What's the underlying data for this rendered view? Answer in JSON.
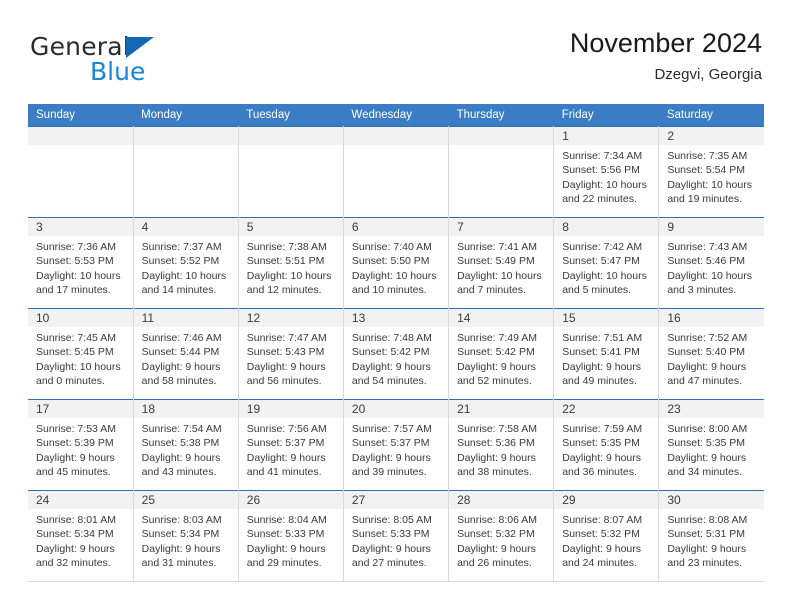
{
  "brand": {
    "name_part1": "General",
    "name_part2": "Blue",
    "triangle_icon": "triangle-icon",
    "color_dark": "#2b2b2b",
    "color_blue": "#1b86d8",
    "color_triangle": "#1368b3"
  },
  "header": {
    "title": "November 2024",
    "subtitle": "Dzegvi, Georgia"
  },
  "calendar": {
    "header_bg": "#3a7dc4",
    "daynum_bg": "#f2f2f2",
    "weekdays": [
      "Sunday",
      "Monday",
      "Tuesday",
      "Wednesday",
      "Thursday",
      "Friday",
      "Saturday"
    ],
    "weeks": [
      [
        {
          "day": "",
          "l1": "",
          "l2": "",
          "l3": "",
          "l4": ""
        },
        {
          "day": "",
          "l1": "",
          "l2": "",
          "l3": "",
          "l4": ""
        },
        {
          "day": "",
          "l1": "",
          "l2": "",
          "l3": "",
          "l4": ""
        },
        {
          "day": "",
          "l1": "",
          "l2": "",
          "l3": "",
          "l4": ""
        },
        {
          "day": "",
          "l1": "",
          "l2": "",
          "l3": "",
          "l4": ""
        },
        {
          "day": "1",
          "l1": "Sunrise: 7:34 AM",
          "l2": "Sunset: 5:56 PM",
          "l3": "Daylight: 10 hours",
          "l4": "and 22 minutes."
        },
        {
          "day": "2",
          "l1": "Sunrise: 7:35 AM",
          "l2": "Sunset: 5:54 PM",
          "l3": "Daylight: 10 hours",
          "l4": "and 19 minutes."
        }
      ],
      [
        {
          "day": "3",
          "l1": "Sunrise: 7:36 AM",
          "l2": "Sunset: 5:53 PM",
          "l3": "Daylight: 10 hours",
          "l4": "and 17 minutes."
        },
        {
          "day": "4",
          "l1": "Sunrise: 7:37 AM",
          "l2": "Sunset: 5:52 PM",
          "l3": "Daylight: 10 hours",
          "l4": "and 14 minutes."
        },
        {
          "day": "5",
          "l1": "Sunrise: 7:38 AM",
          "l2": "Sunset: 5:51 PM",
          "l3": "Daylight: 10 hours",
          "l4": "and 12 minutes."
        },
        {
          "day": "6",
          "l1": "Sunrise: 7:40 AM",
          "l2": "Sunset: 5:50 PM",
          "l3": "Daylight: 10 hours",
          "l4": "and 10 minutes."
        },
        {
          "day": "7",
          "l1": "Sunrise: 7:41 AM",
          "l2": "Sunset: 5:49 PM",
          "l3": "Daylight: 10 hours",
          "l4": "and 7 minutes."
        },
        {
          "day": "8",
          "l1": "Sunrise: 7:42 AM",
          "l2": "Sunset: 5:47 PM",
          "l3": "Daylight: 10 hours",
          "l4": "and 5 minutes."
        },
        {
          "day": "9",
          "l1": "Sunrise: 7:43 AM",
          "l2": "Sunset: 5:46 PM",
          "l3": "Daylight: 10 hours",
          "l4": "and 3 minutes."
        }
      ],
      [
        {
          "day": "10",
          "l1": "Sunrise: 7:45 AM",
          "l2": "Sunset: 5:45 PM",
          "l3": "Daylight: 10 hours",
          "l4": "and 0 minutes."
        },
        {
          "day": "11",
          "l1": "Sunrise: 7:46 AM",
          "l2": "Sunset: 5:44 PM",
          "l3": "Daylight: 9 hours",
          "l4": "and 58 minutes."
        },
        {
          "day": "12",
          "l1": "Sunrise: 7:47 AM",
          "l2": "Sunset: 5:43 PM",
          "l3": "Daylight: 9 hours",
          "l4": "and 56 minutes."
        },
        {
          "day": "13",
          "l1": "Sunrise: 7:48 AM",
          "l2": "Sunset: 5:42 PM",
          "l3": "Daylight: 9 hours",
          "l4": "and 54 minutes."
        },
        {
          "day": "14",
          "l1": "Sunrise: 7:49 AM",
          "l2": "Sunset: 5:42 PM",
          "l3": "Daylight: 9 hours",
          "l4": "and 52 minutes."
        },
        {
          "day": "15",
          "l1": "Sunrise: 7:51 AM",
          "l2": "Sunset: 5:41 PM",
          "l3": "Daylight: 9 hours",
          "l4": "and 49 minutes."
        },
        {
          "day": "16",
          "l1": "Sunrise: 7:52 AM",
          "l2": "Sunset: 5:40 PM",
          "l3": "Daylight: 9 hours",
          "l4": "and 47 minutes."
        }
      ],
      [
        {
          "day": "17",
          "l1": "Sunrise: 7:53 AM",
          "l2": "Sunset: 5:39 PM",
          "l3": "Daylight: 9 hours",
          "l4": "and 45 minutes."
        },
        {
          "day": "18",
          "l1": "Sunrise: 7:54 AM",
          "l2": "Sunset: 5:38 PM",
          "l3": "Daylight: 9 hours",
          "l4": "and 43 minutes."
        },
        {
          "day": "19",
          "l1": "Sunrise: 7:56 AM",
          "l2": "Sunset: 5:37 PM",
          "l3": "Daylight: 9 hours",
          "l4": "and 41 minutes."
        },
        {
          "day": "20",
          "l1": "Sunrise: 7:57 AM",
          "l2": "Sunset: 5:37 PM",
          "l3": "Daylight: 9 hours",
          "l4": "and 39 minutes."
        },
        {
          "day": "21",
          "l1": "Sunrise: 7:58 AM",
          "l2": "Sunset: 5:36 PM",
          "l3": "Daylight: 9 hours",
          "l4": "and 38 minutes."
        },
        {
          "day": "22",
          "l1": "Sunrise: 7:59 AM",
          "l2": "Sunset: 5:35 PM",
          "l3": "Daylight: 9 hours",
          "l4": "and 36 minutes."
        },
        {
          "day": "23",
          "l1": "Sunrise: 8:00 AM",
          "l2": "Sunset: 5:35 PM",
          "l3": "Daylight: 9 hours",
          "l4": "and 34 minutes."
        }
      ],
      [
        {
          "day": "24",
          "l1": "Sunrise: 8:01 AM",
          "l2": "Sunset: 5:34 PM",
          "l3": "Daylight: 9 hours",
          "l4": "and 32 minutes."
        },
        {
          "day": "25",
          "l1": "Sunrise: 8:03 AM",
          "l2": "Sunset: 5:34 PM",
          "l3": "Daylight: 9 hours",
          "l4": "and 31 minutes."
        },
        {
          "day": "26",
          "l1": "Sunrise: 8:04 AM",
          "l2": "Sunset: 5:33 PM",
          "l3": "Daylight: 9 hours",
          "l4": "and 29 minutes."
        },
        {
          "day": "27",
          "l1": "Sunrise: 8:05 AM",
          "l2": "Sunset: 5:33 PM",
          "l3": "Daylight: 9 hours",
          "l4": "and 27 minutes."
        },
        {
          "day": "28",
          "l1": "Sunrise: 8:06 AM",
          "l2": "Sunset: 5:32 PM",
          "l3": "Daylight: 9 hours",
          "l4": "and 26 minutes."
        },
        {
          "day": "29",
          "l1": "Sunrise: 8:07 AM",
          "l2": "Sunset: 5:32 PM",
          "l3": "Daylight: 9 hours",
          "l4": "and 24 minutes."
        },
        {
          "day": "30",
          "l1": "Sunrise: 8:08 AM",
          "l2": "Sunset: 5:31 PM",
          "l3": "Daylight: 9 hours",
          "l4": "and 23 minutes."
        }
      ]
    ]
  }
}
